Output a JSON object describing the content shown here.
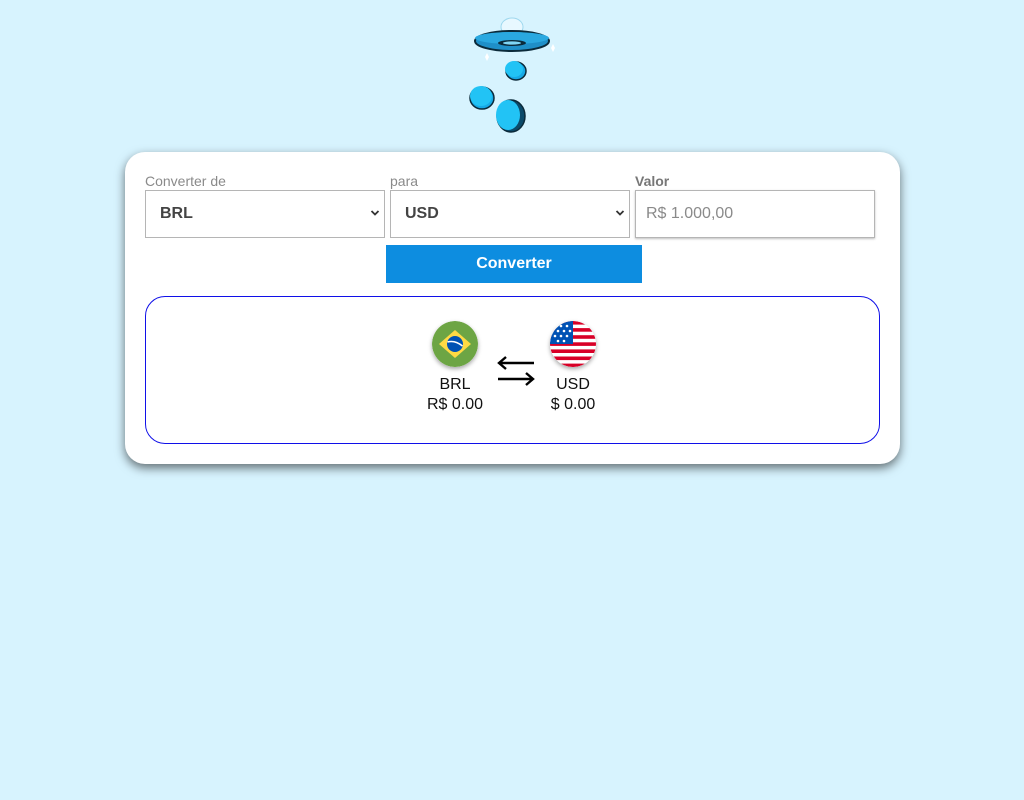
{
  "form": {
    "from_label": "Converter de",
    "from_value": "BRL",
    "to_label": "para",
    "to_value": "USD",
    "amount_label": "Valor",
    "amount_placeholder": "R$ 1.000,00",
    "convert_button": "Converter"
  },
  "result": {
    "from": {
      "code": "BRL",
      "value": "R$ 0.00",
      "flag_icon": "brazil-flag-icon"
    },
    "to": {
      "code": "USD",
      "value": "$ 0.00",
      "flag_icon": "usa-flag-icon"
    },
    "swap_icon": "swap-arrows-icon"
  },
  "colors": {
    "background": "#d7f3fe",
    "accent": "#0d8de0",
    "result_border": "#1010e8"
  }
}
